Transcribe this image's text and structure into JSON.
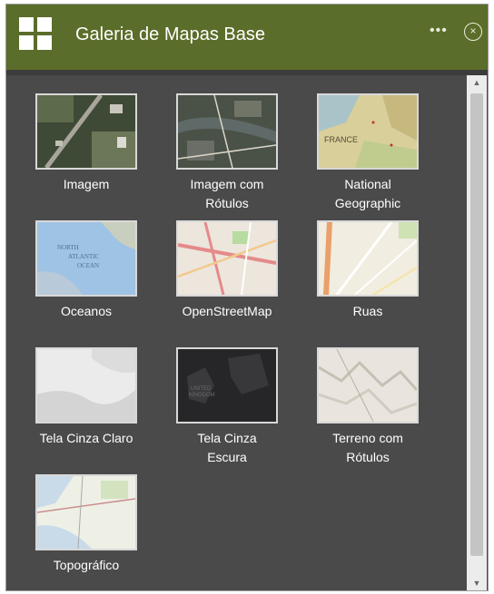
{
  "header": {
    "title": "Galeria de Mapas Base",
    "more_glyph": "•••",
    "close_glyph": "×",
    "bg_color": "#5b6d2a"
  },
  "basemaps": [
    {
      "label": "Imagem",
      "icon": "imagery-thumbnail"
    },
    {
      "label": "Imagem com\nRótulos",
      "icon": "imagery-labels-thumbnail"
    },
    {
      "label": "National\nGeographic",
      "icon": "natgeo-thumbnail"
    },
    {
      "label": "Oceanos",
      "icon": "oceans-thumbnail"
    },
    {
      "label": "OpenStreetMap",
      "icon": "osm-thumbnail"
    },
    {
      "label": "Ruas",
      "icon": "streets-thumbnail"
    },
    {
      "label": "Tela Cinza Claro",
      "icon": "light-gray-thumbnail"
    },
    {
      "label": "Tela Cinza\nEscura",
      "icon": "dark-gray-thumbnail"
    },
    {
      "label": "Terreno com\nRótulos",
      "icon": "terrain-thumbnail"
    },
    {
      "label": "Topográfico",
      "icon": "topographic-thumbnail"
    }
  ],
  "thumb_text": {
    "natgeo": "FRANCE",
    "oceans_1": "NORTH",
    "oceans_2": "ATLANTIC",
    "oceans_3": "OCEAN",
    "dark_1": "UNITED",
    "dark_2": "KINGDOM"
  }
}
